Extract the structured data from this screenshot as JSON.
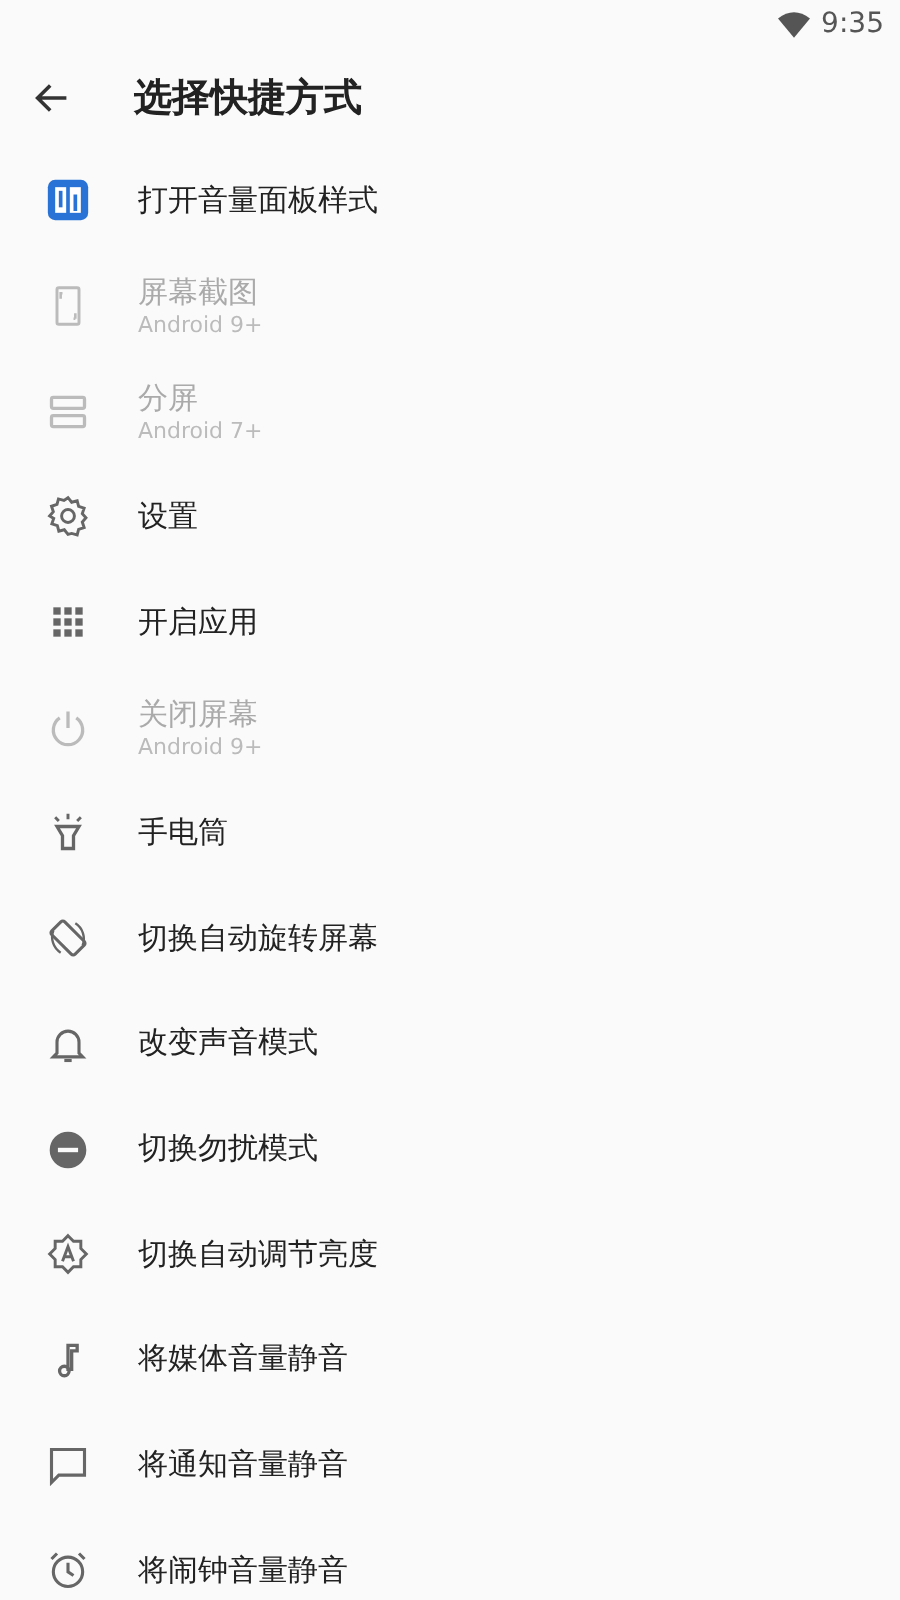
{
  "status_bar": {
    "time": "9:35"
  },
  "toolbar": {
    "title": "选择快捷方式"
  },
  "items": [
    {
      "kind": "panel",
      "label": "打开音量面板样式",
      "disabled": false
    },
    {
      "kind": "screenshot",
      "label": "屏幕截图",
      "sub": "Android 9+",
      "disabled": true
    },
    {
      "kind": "split",
      "label": "分屏",
      "sub": "Android 7+",
      "disabled": true
    },
    {
      "kind": "gear",
      "label": "设置",
      "disabled": false
    },
    {
      "kind": "grid",
      "label": "开启应用",
      "disabled": false
    },
    {
      "kind": "power",
      "label": "关闭屏幕",
      "sub": "Android 9+",
      "disabled": true
    },
    {
      "kind": "flashlight",
      "label": "手电筒",
      "disabled": false
    },
    {
      "kind": "rotate",
      "label": "切换自动旋转屏幕",
      "disabled": false
    },
    {
      "kind": "bell",
      "label": "改变声音模式",
      "disabled": false
    },
    {
      "kind": "dnd",
      "label": "切换勿扰模式",
      "disabled": false
    },
    {
      "kind": "brightness",
      "label": "切换自动调节亮度",
      "disabled": false
    },
    {
      "kind": "note",
      "label": "将媒体音量静音",
      "disabled": false
    },
    {
      "kind": "message",
      "label": "将通知音量静音",
      "disabled": false
    },
    {
      "kind": "alarm",
      "label": "将闹钟音量静音",
      "disabled": false
    }
  ]
}
